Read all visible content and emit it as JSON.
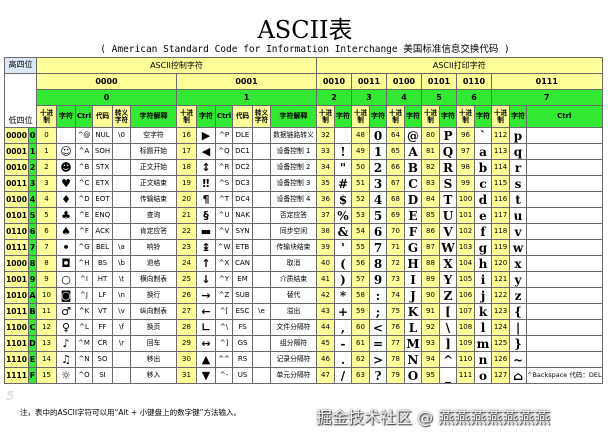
{
  "title": "ASCII表",
  "subtitle": "( American Standard Code for Information Interchange  美国标准信息交换代码 )",
  "header": {
    "high_bits": "高四位",
    "low_bits": "低四位",
    "ctrl_group": "ASCII控制字符",
    "print_group": "ASCII打印字符",
    "ctrl_bits": [
      "0000",
      "0001"
    ],
    "print_bits": [
      "0010",
      "0011",
      "0100",
      "0101",
      "0110",
      "0111"
    ],
    "group_digits": [
      "0",
      "1",
      "2",
      "3",
      "4",
      "5",
      "6",
      "7"
    ],
    "col_decimal": "十进制",
    "col_char": "字符",
    "col_ctrl": "Ctrl",
    "col_code": "代码",
    "col_escape": "转义字符",
    "col_desc": "字符解释",
    "col_ctrl_last": "Ctrl"
  },
  "rows": [
    {
      "bin": "0000",
      "hex": "0",
      "c0": {
        "dec": "0",
        "sym": "",
        "ctrl": "^@",
        "code": "NUL",
        "esc": "\\0",
        "desc": "空字符"
      },
      "c1": {
        "dec": "16",
        "sym": "▶",
        "ctrl": "^P",
        "code": "DLE",
        "esc": "",
        "desc": "数据链路转义"
      },
      "p": [
        [
          "32",
          ""
        ],
        [
          "48",
          "0"
        ],
        [
          "64",
          "@"
        ],
        [
          "80",
          "P"
        ],
        [
          "96",
          "`"
        ],
        [
          "112",
          "p"
        ]
      ],
      "ctrl_last": ""
    },
    {
      "bin": "0001",
      "hex": "1",
      "c0": {
        "dec": "1",
        "sym": "☺",
        "ctrl": "^A",
        "code": "SOH",
        "esc": "",
        "desc": "标题开始"
      },
      "c1": {
        "dec": "17",
        "sym": "◀",
        "ctrl": "^Q",
        "code": "DC1",
        "esc": "",
        "desc": "设备控制 1"
      },
      "p": [
        [
          "33",
          "!"
        ],
        [
          "49",
          "1"
        ],
        [
          "65",
          "A"
        ],
        [
          "81",
          "Q"
        ],
        [
          "97",
          "a"
        ],
        [
          "113",
          "q"
        ]
      ],
      "ctrl_last": ""
    },
    {
      "bin": "0010",
      "hex": "2",
      "c0": {
        "dec": "2",
        "sym": "☻",
        "ctrl": "^B",
        "code": "STX",
        "esc": "",
        "desc": "正文开始"
      },
      "c1": {
        "dec": "18",
        "sym": "↕",
        "ctrl": "^R",
        "code": "DC2",
        "esc": "",
        "desc": "设备控制 2"
      },
      "p": [
        [
          "34",
          "\""
        ],
        [
          "50",
          "2"
        ],
        [
          "66",
          "B"
        ],
        [
          "82",
          "R"
        ],
        [
          "98",
          "b"
        ],
        [
          "114",
          "r"
        ]
      ],
      "ctrl_last": ""
    },
    {
      "bin": "0011",
      "hex": "3",
      "c0": {
        "dec": "3",
        "sym": "♥",
        "ctrl": "^C",
        "code": "ETX",
        "esc": "",
        "desc": "正文结束"
      },
      "c1": {
        "dec": "19",
        "sym": "‼",
        "ctrl": "^S",
        "code": "DC3",
        "esc": "",
        "desc": "设备控制 3"
      },
      "p": [
        [
          "35",
          "#"
        ],
        [
          "51",
          "3"
        ],
        [
          "67",
          "C"
        ],
        [
          "83",
          "S"
        ],
        [
          "99",
          "c"
        ],
        [
          "115",
          "s"
        ]
      ],
      "ctrl_last": ""
    },
    {
      "bin": "0100",
      "hex": "4",
      "c0": {
        "dec": "4",
        "sym": "♦",
        "ctrl": "^D",
        "code": "EOT",
        "esc": "",
        "desc": "传输结束"
      },
      "c1": {
        "dec": "20",
        "sym": "¶",
        "ctrl": "^T",
        "code": "DC4",
        "esc": "",
        "desc": "设备控制 4"
      },
      "p": [
        [
          "36",
          "$"
        ],
        [
          "52",
          "4"
        ],
        [
          "68",
          "D"
        ],
        [
          "84",
          "T"
        ],
        [
          "100",
          "d"
        ],
        [
          "116",
          "t"
        ]
      ],
      "ctrl_last": ""
    },
    {
      "bin": "0101",
      "hex": "5",
      "c0": {
        "dec": "5",
        "sym": "♣",
        "ctrl": "^E",
        "code": "ENQ",
        "esc": "",
        "desc": "查询"
      },
      "c1": {
        "dec": "21",
        "sym": "§",
        "ctrl": "^U",
        "code": "NAK",
        "esc": "",
        "desc": "否定应答"
      },
      "p": [
        [
          "37",
          "%"
        ],
        [
          "53",
          "5"
        ],
        [
          "69",
          "E"
        ],
        [
          "85",
          "U"
        ],
        [
          "101",
          "e"
        ],
        [
          "117",
          "u"
        ]
      ],
      "ctrl_last": ""
    },
    {
      "bin": "0110",
      "hex": "6",
      "c0": {
        "dec": "6",
        "sym": "♠",
        "ctrl": "^F",
        "code": "ACK",
        "esc": "",
        "desc": "肯定应答"
      },
      "c1": {
        "dec": "22",
        "sym": "▬",
        "ctrl": "^V",
        "code": "SYN",
        "esc": "",
        "desc": "同步空闲"
      },
      "p": [
        [
          "38",
          "&"
        ],
        [
          "54",
          "6"
        ],
        [
          "70",
          "F"
        ],
        [
          "86",
          "V"
        ],
        [
          "102",
          "f"
        ],
        [
          "118",
          "v"
        ]
      ],
      "ctrl_last": ""
    },
    {
      "bin": "0111",
      "hex": "7",
      "c0": {
        "dec": "7",
        "sym": "•",
        "ctrl": "^G",
        "code": "BEL",
        "esc": "\\a",
        "desc": "响铃"
      },
      "c1": {
        "dec": "23",
        "sym": "↨",
        "ctrl": "^W",
        "code": "ETB",
        "esc": "",
        "desc": "传输块结束"
      },
      "p": [
        [
          "39",
          "'"
        ],
        [
          "55",
          "7"
        ],
        [
          "71",
          "G"
        ],
        [
          "87",
          "W"
        ],
        [
          "103",
          "g"
        ],
        [
          "119",
          "w"
        ]
      ],
      "ctrl_last": ""
    },
    {
      "bin": "1000",
      "hex": "8",
      "c0": {
        "dec": "8",
        "sym": "◘",
        "ctrl": "^H",
        "code": "BS",
        "esc": "\\b",
        "desc": "退格"
      },
      "c1": {
        "dec": "24",
        "sym": "↑",
        "ctrl": "^X",
        "code": "CAN",
        "esc": "",
        "desc": "取消"
      },
      "p": [
        [
          "40",
          "("
        ],
        [
          "56",
          "8"
        ],
        [
          "72",
          "H"
        ],
        [
          "88",
          "X"
        ],
        [
          "104",
          "h"
        ],
        [
          "120",
          "x"
        ]
      ],
      "ctrl_last": ""
    },
    {
      "bin": "1001",
      "hex": "9",
      "c0": {
        "dec": "9",
        "sym": "○",
        "ctrl": "^I",
        "code": "HT",
        "esc": "\\t",
        "desc": "横向制表"
      },
      "c1": {
        "dec": "25",
        "sym": "↓",
        "ctrl": "^Y",
        "code": "EM",
        "esc": "",
        "desc": "介质结束"
      },
      "p": [
        [
          "41",
          ")"
        ],
        [
          "57",
          "9"
        ],
        [
          "73",
          "I"
        ],
        [
          "89",
          "Y"
        ],
        [
          "105",
          "i"
        ],
        [
          "121",
          "y"
        ]
      ],
      "ctrl_last": ""
    },
    {
      "bin": "1010",
      "hex": "A",
      "c0": {
        "dec": "10",
        "sym": "◙",
        "ctrl": "^J",
        "code": "LF",
        "esc": "\\n",
        "desc": "换行"
      },
      "c1": {
        "dec": "26",
        "sym": "→",
        "ctrl": "^Z",
        "code": "SUB",
        "esc": "",
        "desc": "替代"
      },
      "p": [
        [
          "42",
          "*"
        ],
        [
          "58",
          ":"
        ],
        [
          "74",
          "J"
        ],
        [
          "90",
          "Z"
        ],
        [
          "106",
          "j"
        ],
        [
          "122",
          "z"
        ]
      ],
      "ctrl_last": ""
    },
    {
      "bin": "1011",
      "hex": "B",
      "c0": {
        "dec": "11",
        "sym": "♂",
        "ctrl": "^K",
        "code": "VT",
        "esc": "\\v",
        "desc": "纵向制表"
      },
      "c1": {
        "dec": "27",
        "sym": "←",
        "ctrl": "^[",
        "code": "ESC",
        "esc": "\\e",
        "desc": "溢出"
      },
      "p": [
        [
          "43",
          "+"
        ],
        [
          "59",
          ";"
        ],
        [
          "75",
          "K"
        ],
        [
          "91",
          "["
        ],
        [
          "107",
          "k"
        ],
        [
          "123",
          "{"
        ]
      ],
      "ctrl_last": ""
    },
    {
      "bin": "1100",
      "hex": "C",
      "c0": {
        "dec": "12",
        "sym": "♀",
        "ctrl": "^L",
        "code": "FF",
        "esc": "\\f",
        "desc": "换页"
      },
      "c1": {
        "dec": "28",
        "sym": "∟",
        "ctrl": "^\\",
        "code": "FS",
        "esc": "",
        "desc": "文件分隔符"
      },
      "p": [
        [
          "44",
          ","
        ],
        [
          "60",
          "<"
        ],
        [
          "76",
          "L"
        ],
        [
          "92",
          "\\"
        ],
        [
          "108",
          "l"
        ],
        [
          "124",
          "|"
        ]
      ],
      "ctrl_last": ""
    },
    {
      "bin": "1101",
      "hex": "D",
      "c0": {
        "dec": "13",
        "sym": "♪",
        "ctrl": "^M",
        "code": "CR",
        "esc": "\\r",
        "desc": "回车"
      },
      "c1": {
        "dec": "29",
        "sym": "↔",
        "ctrl": "^]",
        "code": "GS",
        "esc": "",
        "desc": "组分隔符"
      },
      "p": [
        [
          "45",
          "-"
        ],
        [
          "61",
          "="
        ],
        [
          "77",
          "M"
        ],
        [
          "93",
          "]"
        ],
        [
          "109",
          "m"
        ],
        [
          "125",
          "}"
        ]
      ],
      "ctrl_last": ""
    },
    {
      "bin": "1110",
      "hex": "E",
      "c0": {
        "dec": "14",
        "sym": "♫",
        "ctrl": "^N",
        "code": "SO",
        "esc": "",
        "desc": "移出"
      },
      "c1": {
        "dec": "30",
        "sym": "▲",
        "ctrl": "^^",
        "code": "RS",
        "esc": "",
        "desc": "记录分隔符"
      },
      "p": [
        [
          "46",
          "."
        ],
        [
          "62",
          ">"
        ],
        [
          "78",
          "N"
        ],
        [
          "94",
          "^"
        ],
        [
          "110",
          "n"
        ],
        [
          "126",
          "~"
        ]
      ],
      "ctrl_last": ""
    },
    {
      "bin": "1111",
      "hex": "F",
      "c0": {
        "dec": "15",
        "sym": "☼",
        "ctrl": "^O",
        "code": "SI",
        "esc": "",
        "desc": "移入"
      },
      "c1": {
        "dec": "31",
        "sym": "▼",
        "ctrl": "^-",
        "code": "US",
        "esc": "",
        "desc": "单元分隔符"
      },
      "p": [
        [
          "47",
          "/"
        ],
        [
          "63",
          "?"
        ],
        [
          "79",
          "O"
        ],
        [
          "95",
          "_"
        ],
        [
          "111",
          "o"
        ],
        [
          "127",
          "⌂"
        ]
      ],
      "ctrl_last": "^Backspace 代码：DEL"
    }
  ],
  "footnote": "注，表中的ASCII字符可以用“Alt + 小键盘上的数字键”方法输入。",
  "watermark": "掘金技术社区 @ 燕燕燕燕燕燕燕",
  "watermark_left": "5"
}
